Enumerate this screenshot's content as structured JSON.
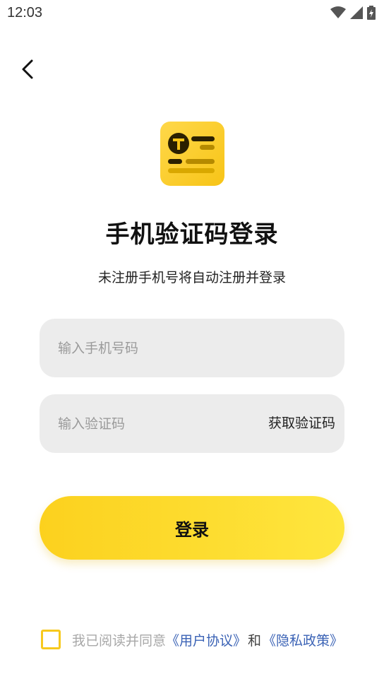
{
  "status_bar": {
    "time": "12:03",
    "icons": [
      "wifi-icon",
      "signal-icon",
      "battery-charging-icon"
    ]
  },
  "nav": {
    "back_icon": "chevron-left-icon"
  },
  "logo": {
    "icon": "app-logo",
    "color": "#fcd11e"
  },
  "title": "手机验证码登录",
  "subtitle": "未注册手机号将自动注册并登录",
  "phone_input": {
    "placeholder": "输入手机号码",
    "value": ""
  },
  "code_input": {
    "placeholder": "输入验证码",
    "value": ""
  },
  "get_code_label": "获取验证码",
  "login_label": "登录",
  "agreement": {
    "checked": false,
    "prefix": "我已阅读并同意",
    "user_agreement": "《用户协议》",
    "and": "和",
    "privacy_policy": "《隐私政策》"
  },
  "colors": {
    "accent_yellow": "#fcd11e",
    "link_blue": "#3a62b5",
    "input_bg": "#ececec"
  }
}
